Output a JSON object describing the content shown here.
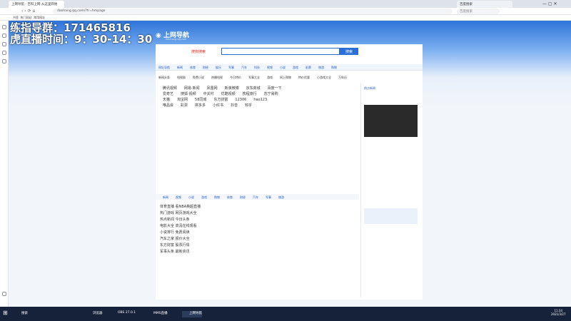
{
  "browser": {
    "active_tab": "上网导航 - 百科上网 从这里开始",
    "second_tab": "百度搜索",
    "address": "daohang.qq.com/?fr=hmpage",
    "search_box": "百度搜索",
    "bookmarks": [
      "书签",
      "热门网站",
      "常用网址",
      "购物",
      "游戏",
      "视频",
      "小说"
    ]
  },
  "overlay": {
    "line1": "练指导群：171465816",
    "line2": "虎直播时间：9：30-14：30"
  },
  "site": {
    "logo": "上网导航",
    "logo_sub": "daohang.qq.com",
    "search_button": "搜索",
    "hot_search": "搜狗搜索",
    "nav": [
      "网址导航",
      "新闻",
      "体育",
      "财经",
      "娱乐",
      "军事",
      "汽车",
      "科技",
      "视频",
      "小说",
      "游戏",
      "彩票",
      "旅游",
      "购物"
    ],
    "quick": [
      "新闻头条",
      "电视剧",
      "免费小说",
      "热播电视",
      "今日特价",
      "军事大全",
      "游戏",
      "网上购物",
      "特价优惠",
      "小游戏大全",
      "万年历"
    ],
    "grid": [
      [
        "腾讯视频",
        "网易·新闻",
        "凤凰网",
        "新浪微博",
        "京东商城",
        "百度一下"
      ],
      [
        "爱奇艺",
        "搜狐·视频",
        "中关村",
        "优酷视频",
        "携程旅行",
        "苏宁易购"
      ],
      [
        "天猫",
        "淘宝网",
        "58同城",
        "东方财富",
        "12306",
        "hao123"
      ],
      [
        "唯品会",
        "彩票",
        "拼多多",
        "小红书",
        "抖音",
        "知乎"
      ]
    ],
    "cats": [
      "新闻",
      "视频",
      "小说",
      "游戏",
      "购物",
      "体育",
      "财经",
      "汽车",
      "军事",
      "旅游"
    ],
    "list": [
      "体育直播 看NBA英超直播",
      "热门游戏 网页游戏大全",
      "热点新闻 今日头条",
      "电影大全 高清在线观看",
      "小说排行 免费阅读",
      "汽车之家 报价大全",
      "东方财富 股票行情",
      "军事头条 最新资讯"
    ],
    "news_title": "热点新闻",
    "time": "11:34",
    "date": "2021/3/27"
  },
  "taskbar": {
    "apps": [
      "搜索",
      "浏览器",
      "上网导航",
      "OBS 27.0.1",
      "MMS直播"
    ]
  }
}
